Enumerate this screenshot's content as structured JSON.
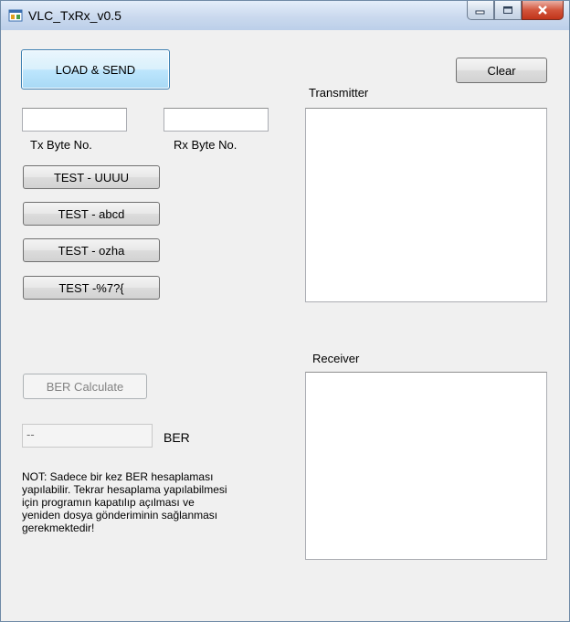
{
  "window": {
    "title": "VLC_TxRx_v0.5"
  },
  "buttons": {
    "load_send": "LOAD & SEND",
    "clear": "Clear",
    "test_u": "TEST - UUUU",
    "test_abcd": "TEST - abcd",
    "test_ozha": "TEST - ozha",
    "test_sym": "TEST -%7?{",
    "ber_calculate": "BER Calculate"
  },
  "labels": {
    "tx_byte": "Tx Byte No.",
    "rx_byte": "Rx Byte No.",
    "transmitter": "Transmitter",
    "receiver": "Receiver",
    "ber": "BER"
  },
  "fields": {
    "tx_byte_value": "",
    "rx_byte_value": "",
    "ber_value": "--",
    "transmitter_text": "",
    "receiver_text": ""
  },
  "note": {
    "lines": [
      "NOT: Sadece bir kez BER hesaplaması",
      "yapılabilir. Tekrar hesaplama yapılabilmesi",
      "için programın kapatılıp açılması ve",
      "yeniden dosya gönderiminin sağlanması",
      "gerekmektedir!"
    ]
  }
}
